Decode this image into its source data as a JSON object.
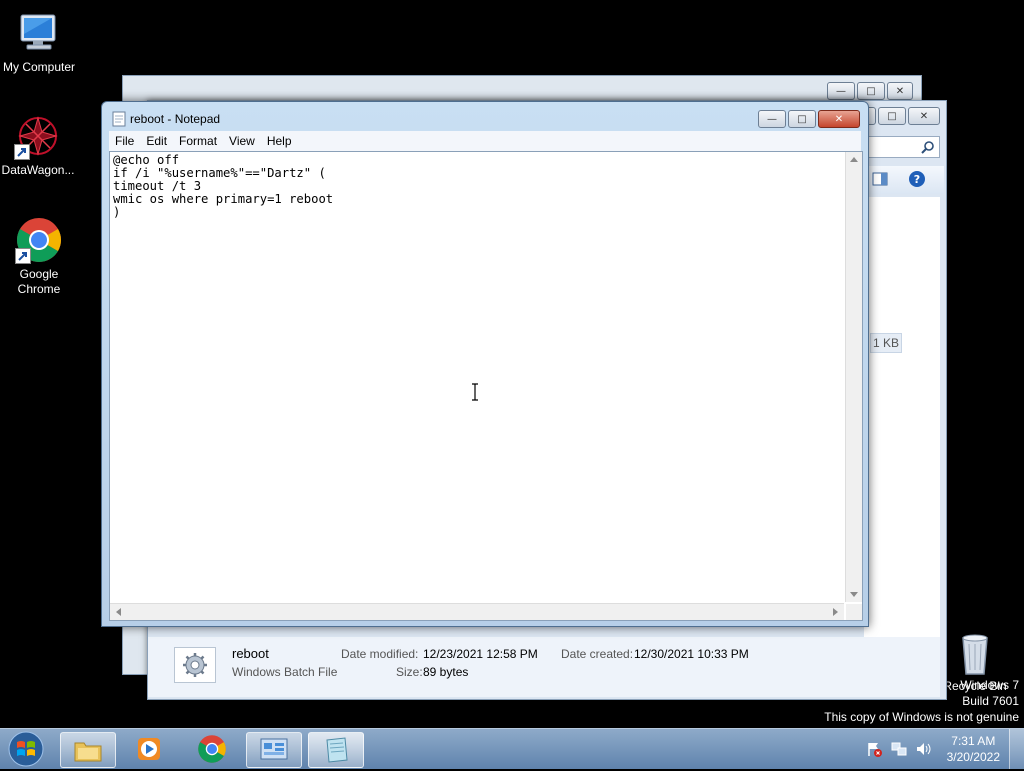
{
  "desktop": {
    "icons": [
      {
        "label": "My Computer"
      },
      {
        "label": "DataWagon..."
      },
      {
        "label": "Google Chrome"
      },
      {
        "label": "Recycle Bin"
      }
    ]
  },
  "notepad": {
    "title": "reboot - Notepad",
    "menu": [
      "File",
      "Edit",
      "Format",
      "View",
      "Help"
    ],
    "content": "@echo off\nif /i \"%username%\"==\"Dartz\" (\ntimeout /t 3\nwmic os where primary=1 reboot\n)"
  },
  "explorer": {
    "size_column_value": "1 KB",
    "details": {
      "file_name": "reboot",
      "file_type": "Windows Batch File",
      "date_modified_label": "Date modified:",
      "date_modified": "12/23/2021 12:58 PM",
      "date_created_label": "Date created:",
      "date_created": "12/30/2021 10:33 PM",
      "size_label": "Size:",
      "size": "89 bytes"
    }
  },
  "watermark": {
    "line1": "Windows 7",
    "line2": "Build 7601",
    "line3": "This copy of Windows is not genuine"
  },
  "taskbar": {
    "time": "7:31 AM",
    "date": "3/20/2022"
  },
  "colors": {
    "taskbar": "#6f92bb",
    "desktop": "#000000"
  }
}
